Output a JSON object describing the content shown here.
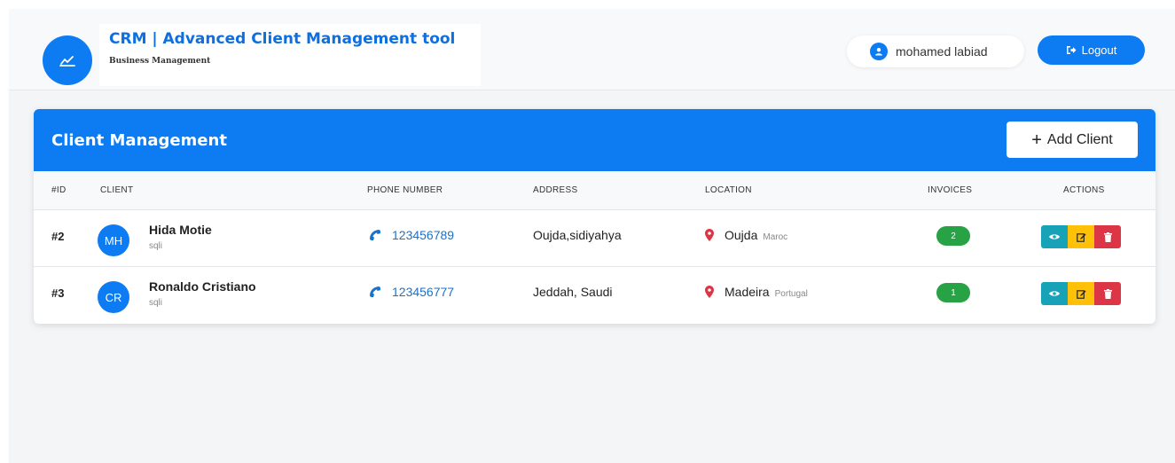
{
  "header": {
    "title": "CRM | Advanced Client Management tool",
    "subtitle": "Business Management",
    "user_name": "mohamed labiad",
    "logout_label": "Logout"
  },
  "card": {
    "title": "Client Management",
    "add_button_label": "Add Client"
  },
  "table": {
    "columns": [
      "#ID",
      "CLIENT",
      "PHONE NUMBER",
      "ADDRESS",
      "LOCATION",
      "INVOICES",
      "ACTIONS"
    ],
    "rows": [
      {
        "id": "#2",
        "initials": "MH",
        "name": "Hida Motie",
        "company": "sqli",
        "phone": "123456789",
        "address": "Oujda,sidiyahya",
        "city": "Oujda",
        "country": "Maroc",
        "invoices": "2"
      },
      {
        "id": "#3",
        "initials": "CR",
        "name": "Ronaldo Cristiano",
        "company": "sqli",
        "phone": "123456777",
        "address": "Jeddah, Saudi",
        "city": "Madeira",
        "country": "Portugal",
        "invoices": "1"
      }
    ]
  },
  "icons": {
    "brand": "chart-line-icon",
    "user": "user-circle-icon",
    "logout": "sign-out-icon",
    "add": "plus-icon",
    "phone": "phone-icon",
    "location": "map-marker-icon",
    "view": "eye-icon",
    "edit": "edit-icon",
    "delete": "trash-icon"
  },
  "colors": {
    "primary": "#0d7bf2",
    "success": "#27a245",
    "info": "#17a2b8",
    "warning": "#ffc107",
    "danger": "#dc3545",
    "location_pin": "#dc3545"
  }
}
